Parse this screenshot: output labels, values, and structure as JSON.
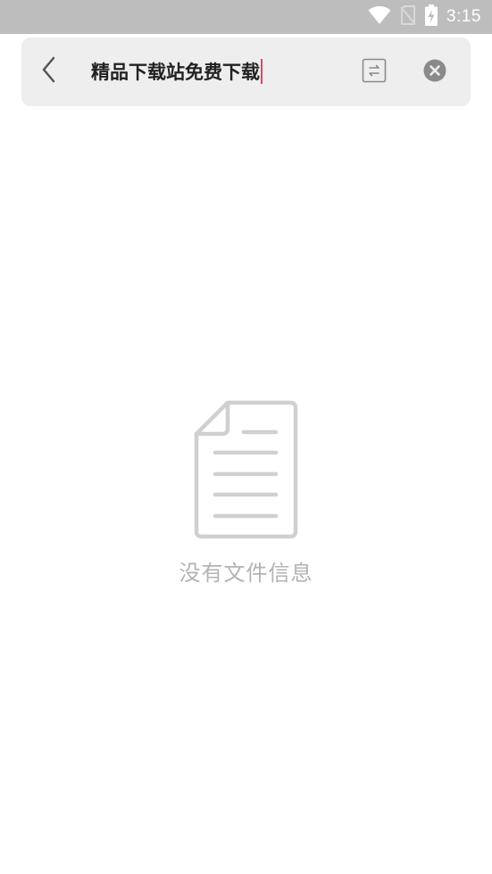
{
  "status_bar": {
    "time": "3:15",
    "icons": [
      "wifi-icon",
      "no-sim-icon",
      "battery-charging-icon"
    ]
  },
  "search_bar": {
    "query": "精品下载站免费下载",
    "back_icon": "chevron-left-icon",
    "swap_icon": "swap-icon",
    "clear_icon": "clear-icon"
  },
  "empty_state": {
    "icon": "document-icon",
    "message": "没有文件信息"
  },
  "colors": {
    "status_bar_bg": "#bdbdbd",
    "search_bg": "#eeeeee",
    "caret": "#e0475a",
    "muted": "#b3b3b3"
  }
}
